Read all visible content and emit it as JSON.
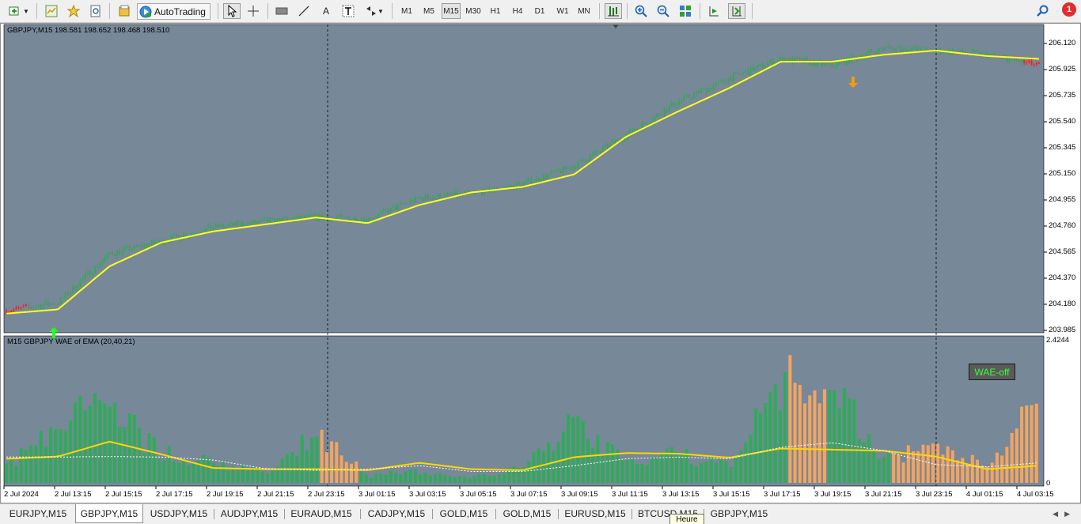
{
  "toolbar": {
    "autotrading_label": "AutoTrading",
    "timeframes": [
      "M1",
      "M5",
      "M15",
      "M30",
      "H1",
      "H4",
      "D1",
      "W1",
      "MN"
    ],
    "active_timeframe": "M15",
    "notification_count": "1"
  },
  "chart": {
    "header": "GBPJPY,M15  198.581 198.652 198.468 198.510",
    "indicator_label": "M15 GBPJPY WAE of EMA (20,40,21)",
    "wae_badge": "WAE-off",
    "indicator_max_label": "2.4244",
    "indicator_zero_label": "0",
    "price_ticks": [
      "206.120",
      "205.925",
      "205.735",
      "205.540",
      "205.345",
      "205.150",
      "204.955",
      "204.760",
      "204.565",
      "204.370",
      "204.180",
      "203.985"
    ],
    "time_labels": [
      "2 Jul 2024",
      "2 Jul 13:15",
      "2 Jul 15:15",
      "2 Jul 17:15",
      "2 Jul 19:15",
      "2 Jul 21:15",
      "2 Jul 23:15",
      "3 Jul 01:15",
      "3 Jul 03:15",
      "3 Jul 05:15",
      "3 Jul 07:15",
      "3 Jul 09:15",
      "3 Jul 11:15",
      "3 Jul 13:15",
      "3 Jul 15:15",
      "3 Jul 17:15",
      "3 Jul 19:15",
      "3 Jul 21:15",
      "3 Jul 23:15",
      "4 Jul 01:15",
      "4 Jul 03:15"
    ],
    "colors": {
      "background": "#778899",
      "bull": "#2eab57",
      "bear": "#ff1a1a",
      "ma": "#ffff1a",
      "wae_up": "#2eab57",
      "wae_down": "#f4a460",
      "signal": "#ffd700",
      "deadzone": "#ffffff",
      "arrow_buy": "#22ff22",
      "arrow_sell": "#ff9a00"
    }
  },
  "tabs": {
    "items": [
      "EURJPY,M15",
      "GBPJPY,M15",
      "USDJPY,M15",
      "AUDJPY,M15",
      "EURAUD,M15",
      "CADJPY,M15",
      "GOLD,M15",
      "GOLD,M15",
      "EURUSD,M15",
      "BTCUSD,M15",
      "GBPJPY,M15"
    ],
    "active_index": 1,
    "tooltip": "Heure"
  },
  "chart_data": {
    "type": "line",
    "title": "GBPJPY,M15",
    "price_range": [
      203.985,
      206.12
    ],
    "price_series": {
      "name": "",
      "x": [
        "2 Jul 11:15",
        "2 Jul 13:15",
        "2 Jul 15:15",
        "2 Jul 17:15",
        "2 Jul 19:15",
        "2 Jul 21:15",
        "2 Jul 23:15",
        "3 Jul 01:15",
        "3 Jul 03:15",
        "3 Jul 05:15",
        "3 Jul 07:15",
        "3 Jul 09:15",
        "3 Jul 11:15",
        "3 Jul 13:15",
        "3 Jul 15:15",
        "3 Jul 17:15",
        "3 Jul 19:15",
        "3 Jul 21:15",
        "3 Jul 23:15",
        "4 Jul 01:15",
        "4 Jul 03:15"
      ],
      "close": [
        204.12,
        204.18,
        204.53,
        204.62,
        204.72,
        204.76,
        204.79,
        204.78,
        204.93,
        204.96,
        205.03,
        205.16,
        205.38,
        205.62,
        205.79,
        205.93,
        205.88,
        206.01,
        205.99,
        205.96,
        205.88
      ],
      "ma": [
        204.1,
        204.13,
        204.44,
        204.61,
        204.69,
        204.74,
        204.79,
        204.75,
        204.88,
        204.97,
        205.01,
        205.1,
        205.37,
        205.55,
        205.72,
        205.91,
        205.91,
        205.96,
        205.99,
        205.95,
        205.93
      ]
    },
    "indicator_range": [
      0,
      2.4244
    ],
    "indicator_series": {
      "name": "WAE",
      "x": [
        "2 Jul 11:15",
        "2 Jul 13:15",
        "2 Jul 15:15",
        "2 Jul 17:15",
        "2 Jul 19:15",
        "2 Jul 21:15",
        "2 Jul 23:15",
        "3 Jul 01:15",
        "3 Jul 03:15",
        "3 Jul 05:15",
        "3 Jul 07:15",
        "3 Jul 09:15",
        "3 Jul 11:15",
        "3 Jul 13:15",
        "3 Jul 15:15",
        "3 Jul 17:15",
        "3 Jul 19:15",
        "3 Jul 21:15",
        "3 Jul 23:15",
        "4 Jul 01:15",
        "4 Jul 03:15"
      ],
      "histogram": [
        0.35,
        1.35,
        1.55,
        0.62,
        0.4,
        0.22,
        1.0,
        0.15,
        0.25,
        0.1,
        0.32,
        1.25,
        0.4,
        0.6,
        0.35,
        2.1,
        2.0,
        0.5,
        0.8,
        0.35,
        1.7
      ],
      "signal": [
        0.42,
        0.46,
        0.72,
        0.5,
        0.26,
        0.24,
        0.24,
        0.22,
        0.35,
        0.24,
        0.22,
        0.45,
        0.52,
        0.51,
        0.44,
        0.6,
        0.58,
        0.56,
        0.46,
        0.24,
        0.3
      ],
      "deadzone": [
        0.45,
        0.45,
        0.46,
        0.45,
        0.4,
        0.25,
        0.22,
        0.24,
        0.3,
        0.2,
        0.2,
        0.3,
        0.42,
        0.45,
        0.42,
        0.62,
        0.7,
        0.56,
        0.32,
        0.28,
        0.35
      ]
    },
    "signals": [
      {
        "type": "buy",
        "x": "2 Jul 12:45",
        "price": 204.07
      },
      {
        "type": "sell",
        "x": "3 Jul 19:45",
        "price": 205.81
      }
    ]
  }
}
